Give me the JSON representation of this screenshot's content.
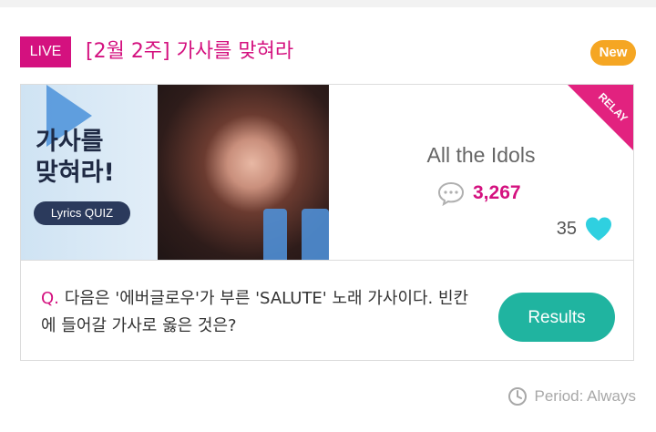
{
  "header": {
    "live_label": "LIVE",
    "title": "[2월 2주] 가사를 맞혀라",
    "new_label": "New"
  },
  "banner": {
    "title_line1": "가사를",
    "title_line2": "맞혀라!",
    "pill_label": "Lyrics QUIZ"
  },
  "info": {
    "relay_label": "RELAY",
    "group_name": "All the Idols",
    "comment_count": "3,267",
    "like_count": "35"
  },
  "question": {
    "prefix": "Q.",
    "text": "다음은 '에버글로우'가 부른 'SALUTE' 노래 가사이다. 빈칸에 들어갈 가사로 옳은 것은?"
  },
  "results_label": "Results",
  "period": {
    "text": "Period: Always"
  },
  "colors": {
    "accent": "#d4117f",
    "new_badge": "#f5a623",
    "results": "#20b4a0",
    "heart": "#2fd0e0"
  }
}
